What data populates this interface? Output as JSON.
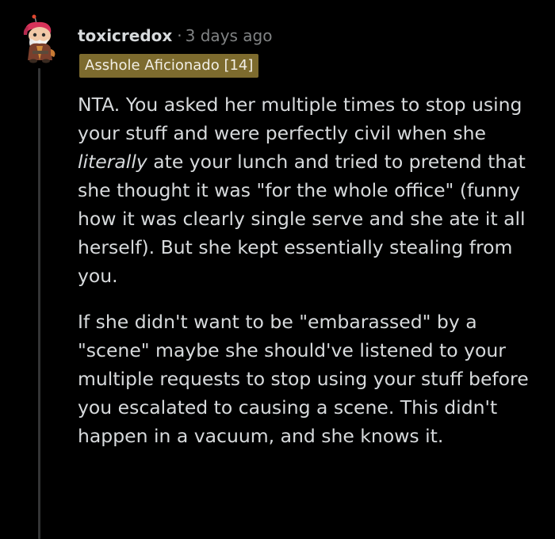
{
  "comment": {
    "username": "toxicredox",
    "separator": "·",
    "timestamp": "3 days ago",
    "flair": "Asshole Aficionado [14]",
    "flair_color": "#7d6b2e",
    "avatar_icon": "snoo-avatar-icon",
    "paragraph1": {
      "before_emphasis": "NTA. You asked her multiple times to stop using your stuff and were perfectly civil when she ",
      "emphasis": "literally",
      "after_emphasis": " ate your lunch and tried to pretend that she thought it was \"for the whole office\" (funny how it was clearly single serve and she ate it all herself). But she kept essentially stealing from you."
    },
    "paragraph2": "If she didn't want to be \"embarassed\" by a \"scene\" maybe she should've listened to your multiple requests to stop using your stuff before you escalated to causing a scene. This didn't happen in a vacuum, and she knows it."
  }
}
